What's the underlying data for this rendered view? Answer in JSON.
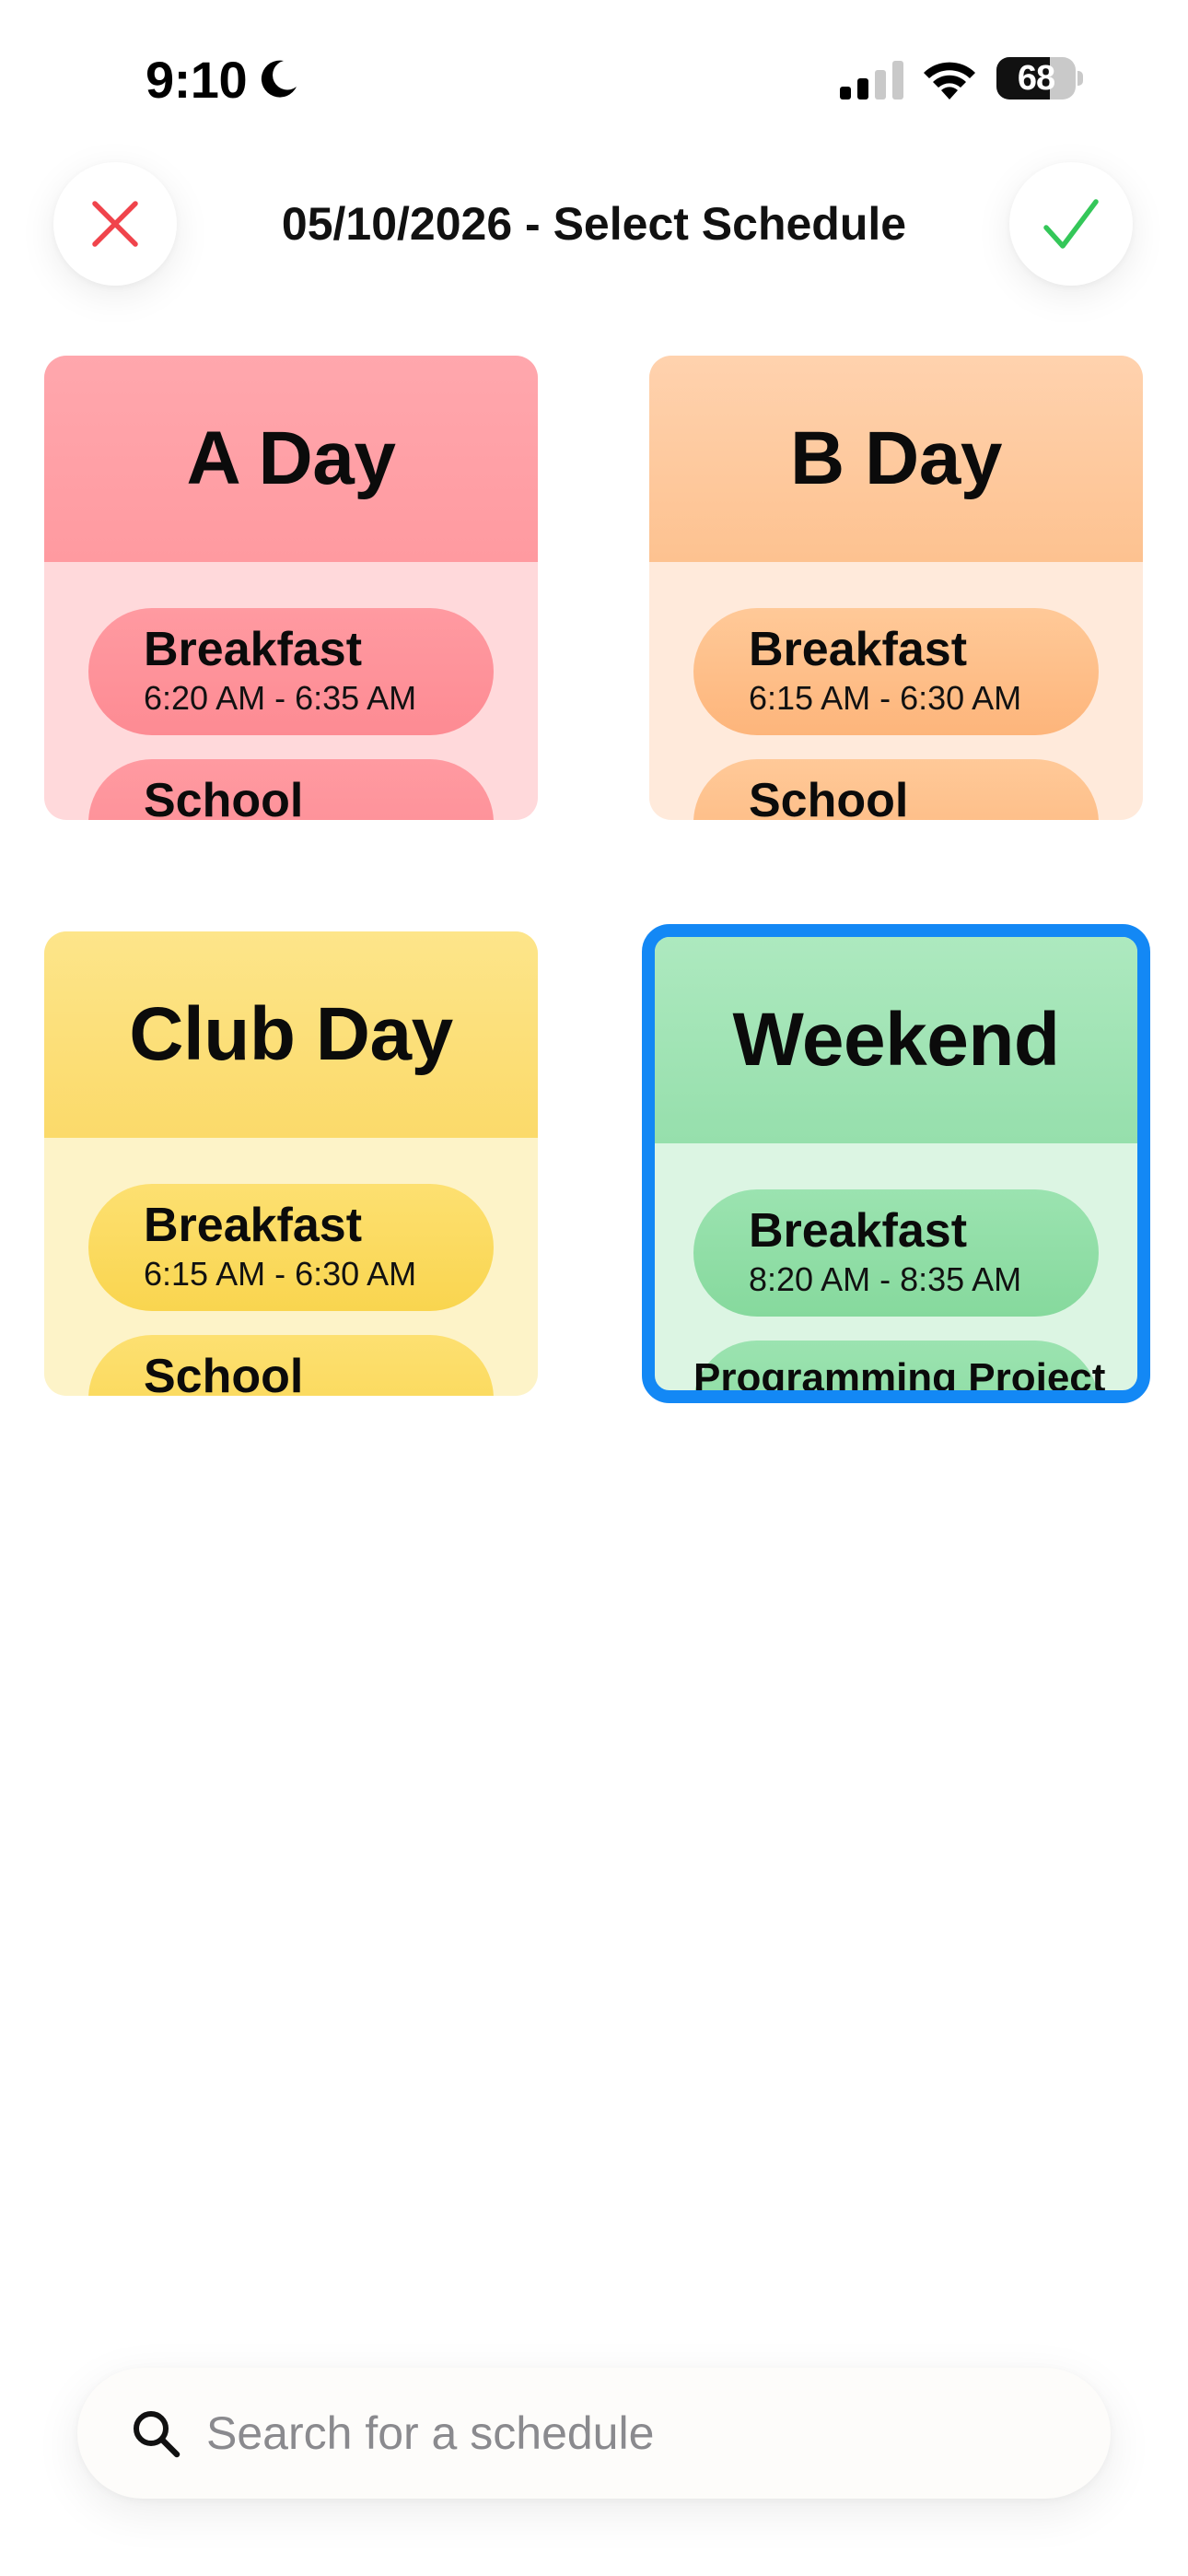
{
  "status_bar": {
    "time": "9:10",
    "battery_level": "68",
    "icons": [
      "moon-icon",
      "cellular-signal-icon",
      "wifi-icon",
      "battery-icon"
    ]
  },
  "header": {
    "title": "05/10/2026 - Select Schedule",
    "close_icon": "close-icon",
    "confirm_icon": "checkmark-icon",
    "close_color": "#f0444c",
    "confirm_color": "#34c759"
  },
  "schedules": [
    {
      "name": "A Day",
      "color": "#ff9aa0",
      "events": [
        {
          "name": "Breakfast",
          "time": "6:20 AM - 6:35 AM"
        },
        {
          "name": "School"
        }
      ]
    },
    {
      "name": "B Day",
      "color": "#fdc290",
      "events": [
        {
          "name": "Breakfast",
          "time": "6:15 AM - 6:30 AM"
        },
        {
          "name": "School"
        }
      ]
    },
    {
      "name": "Club Day",
      "color": "#fbda6a",
      "events": [
        {
          "name": "Breakfast",
          "time": "6:15 AM - 6:30 AM"
        },
        {
          "name": "School"
        }
      ]
    },
    {
      "name": "Weekend",
      "color": "#96dfac",
      "selected": true,
      "events": [
        {
          "name": "Breakfast",
          "time": "8:20 AM - 8:35 AM"
        },
        {
          "name": "Programming Project"
        }
      ]
    }
  ],
  "selection_color": "#1388f5",
  "search": {
    "placeholder": "Search for a schedule",
    "value": "",
    "icon": "search-icon"
  }
}
